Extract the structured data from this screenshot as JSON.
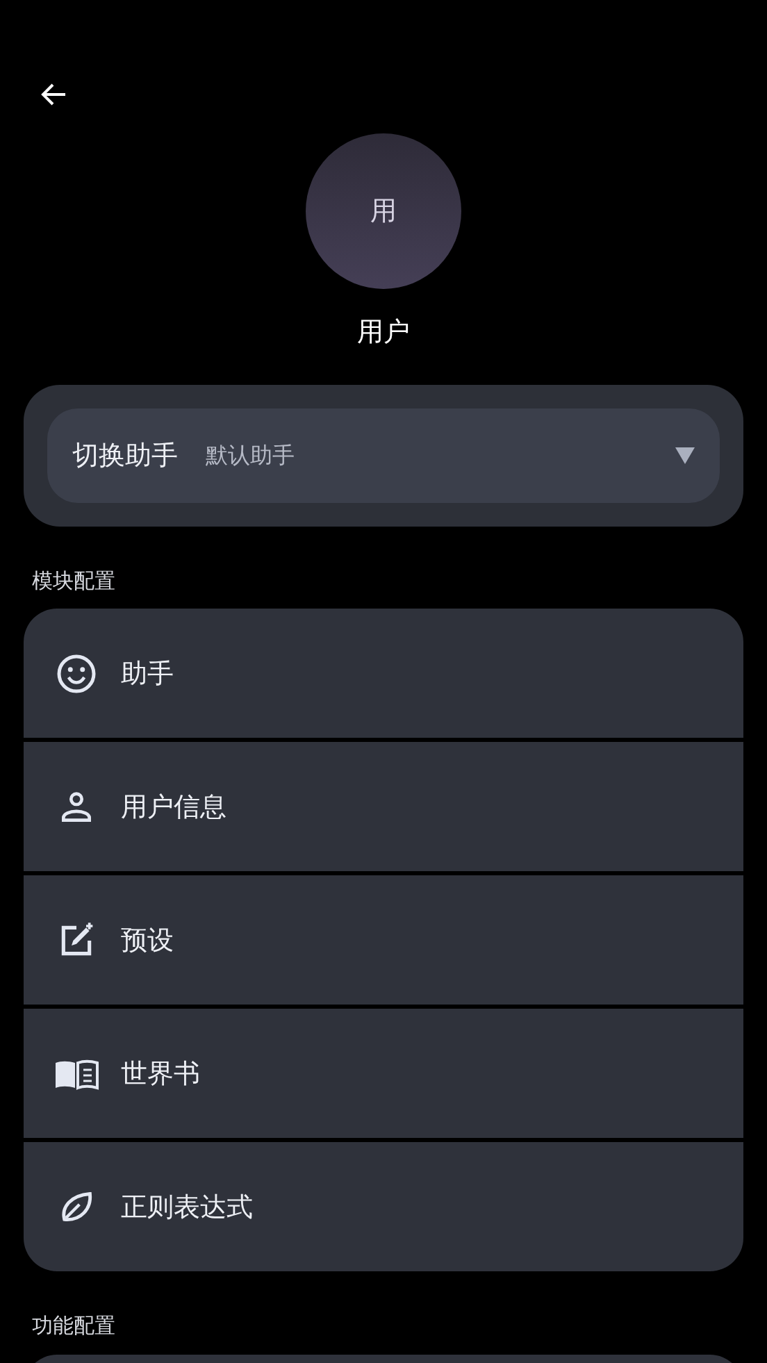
{
  "avatar": {
    "initial": "用"
  },
  "user_name": "用户",
  "assistant_switch": {
    "label": "切换助手",
    "value": "默认助手"
  },
  "sections": [
    {
      "title": "模块配置",
      "items": [
        {
          "kind": "smiley",
          "label": "助手"
        },
        {
          "kind": "person",
          "label": "用户信息"
        },
        {
          "kind": "edit",
          "label": "预设"
        },
        {
          "kind": "book",
          "label": "世界书"
        },
        {
          "kind": "leaf",
          "label": "正则表达式"
        }
      ]
    },
    {
      "title": "功能配置"
    }
  ]
}
